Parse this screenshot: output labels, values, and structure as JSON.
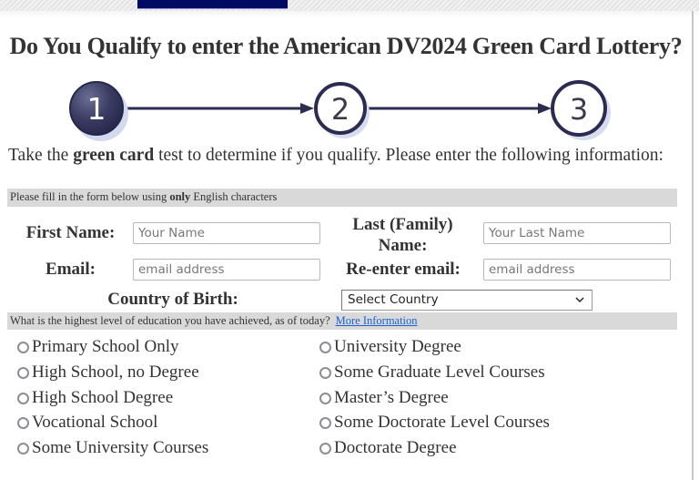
{
  "header": {
    "title": "Do You Qualify to enter the American DV2024 Green Card Lottery?"
  },
  "steps": {
    "items": [
      {
        "number": "1",
        "state": "active"
      },
      {
        "number": "2",
        "state": "inactive"
      },
      {
        "number": "3",
        "state": "inactive"
      }
    ],
    "colors": {
      "active_fill": "#35375e",
      "stroke": "#2b2c50",
      "halo": "#cfd6ec"
    }
  },
  "intro": {
    "prefix": "Take the ",
    "bold": "green card",
    "suffix": " test to determine if you qualify. Please enter the following information:"
  },
  "form": {
    "notice_prefix": "Please fill in the form below using ",
    "notice_bold": "only",
    "notice_suffix": " English characters",
    "first_name_label": "First Name:",
    "first_name_placeholder": "Your Name",
    "first_name_value": "",
    "last_name_label_line1": "Last (Family)",
    "last_name_label_line2": "Name:",
    "last_name_placeholder": "Your Last Name",
    "last_name_value": "",
    "email_label": "Email:",
    "email_placeholder": "email address",
    "email_value": "",
    "reemail_label": "Re-enter email:",
    "reemail_placeholder": "email address",
    "reemail_value": "",
    "country_label": "Country of Birth:",
    "country_selected": "Select Country",
    "chevron_glyph": "⌄"
  },
  "education": {
    "question": "What is the highest level of education you have achieved, as of today?",
    "more_info_link": "More Information",
    "link_color": "#1a5fd6",
    "left_options": [
      "Primary School Only",
      "High School, no Degree",
      "High School Degree",
      "Vocational School",
      "Some University Courses"
    ],
    "right_options": [
      "University Degree",
      "Some Graduate Level Courses",
      "Master’s Degree",
      "Some Doctorate Level Courses",
      "Doctorate Degree"
    ]
  },
  "colors": {
    "nav_tab": "#020b64",
    "band": "#d9d9d9",
    "text": "#333333"
  }
}
